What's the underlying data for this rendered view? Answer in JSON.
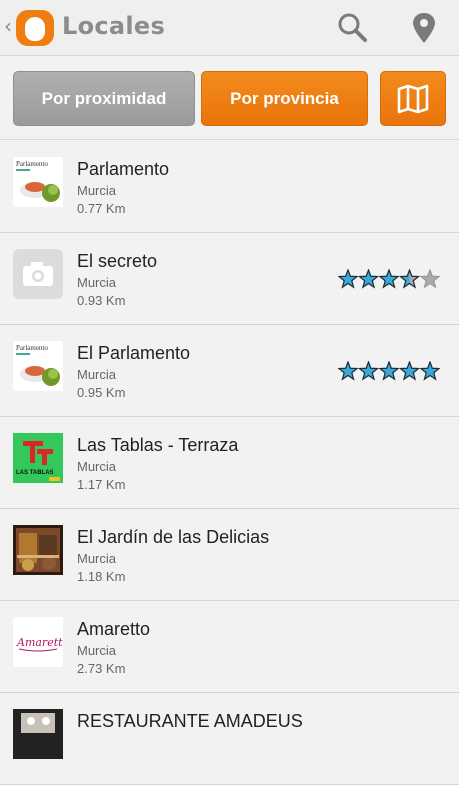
{
  "header": {
    "title": "Locales",
    "back_icon": "chevron-left-icon",
    "search_icon": "search-icon",
    "location_icon": "map-pin-icon"
  },
  "tabs": {
    "proximity_label": "Por proximidad",
    "province_label": "Por provincia",
    "map_icon": "map-icon"
  },
  "colors": {
    "accent": "#ef7d0f",
    "star": "#3aa8d8",
    "star_empty": "#aaaaaa"
  },
  "places": [
    {
      "name": "Parlamento",
      "city": "Murcia",
      "distance": "0.77 Km",
      "rating": null,
      "thumb": "parlamento",
      "thumb_text": "Parlamento"
    },
    {
      "name": "El secreto",
      "city": "Murcia",
      "distance": "0.93 Km",
      "rating": 3.5,
      "thumb": "camera",
      "thumb_text": ""
    },
    {
      "name": "El Parlamento",
      "city": "Murcia",
      "distance": "0.95 Km",
      "rating": 5,
      "thumb": "parlamento",
      "thumb_text": "Parlamento"
    },
    {
      "name": "Las Tablas - Terraza",
      "city": "Murcia",
      "distance": "1.17 Km",
      "rating": null,
      "thumb": "tablas",
      "thumb_text": "LAS TABLAS"
    },
    {
      "name": "El Jardín de las Delicias",
      "city": "Murcia",
      "distance": "1.18 Km",
      "rating": null,
      "thumb": "painting",
      "thumb_text": ""
    },
    {
      "name": "Amaretto",
      "city": "Murcia",
      "distance": "2.73 Km",
      "rating": null,
      "thumb": "amaretto",
      "thumb_text": "Amaretto"
    },
    {
      "name": "RESTAURANTE AMADEUS",
      "city": "",
      "distance": "",
      "rating": null,
      "thumb": "dark",
      "thumb_text": ""
    }
  ]
}
